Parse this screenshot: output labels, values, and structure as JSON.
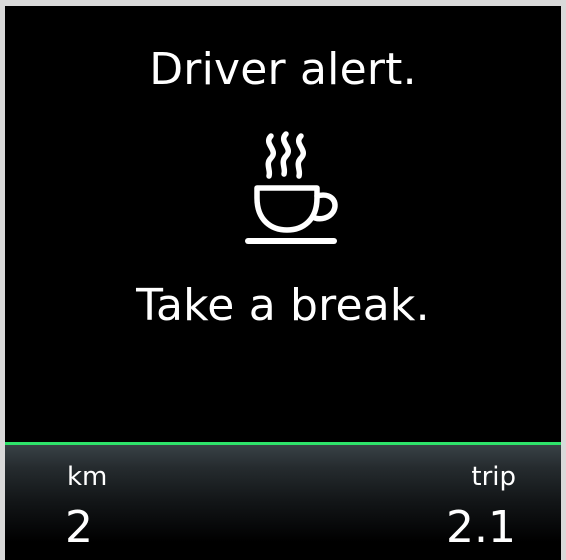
{
  "alert": {
    "title": "Driver alert.",
    "message": "Take a break.",
    "icon": "coffee-cup-icon"
  },
  "trip_bar": {
    "left_label": "km",
    "left_value": "2",
    "right_label": "trip",
    "right_value": "2.1",
    "accent_color": "#2ee36a"
  }
}
